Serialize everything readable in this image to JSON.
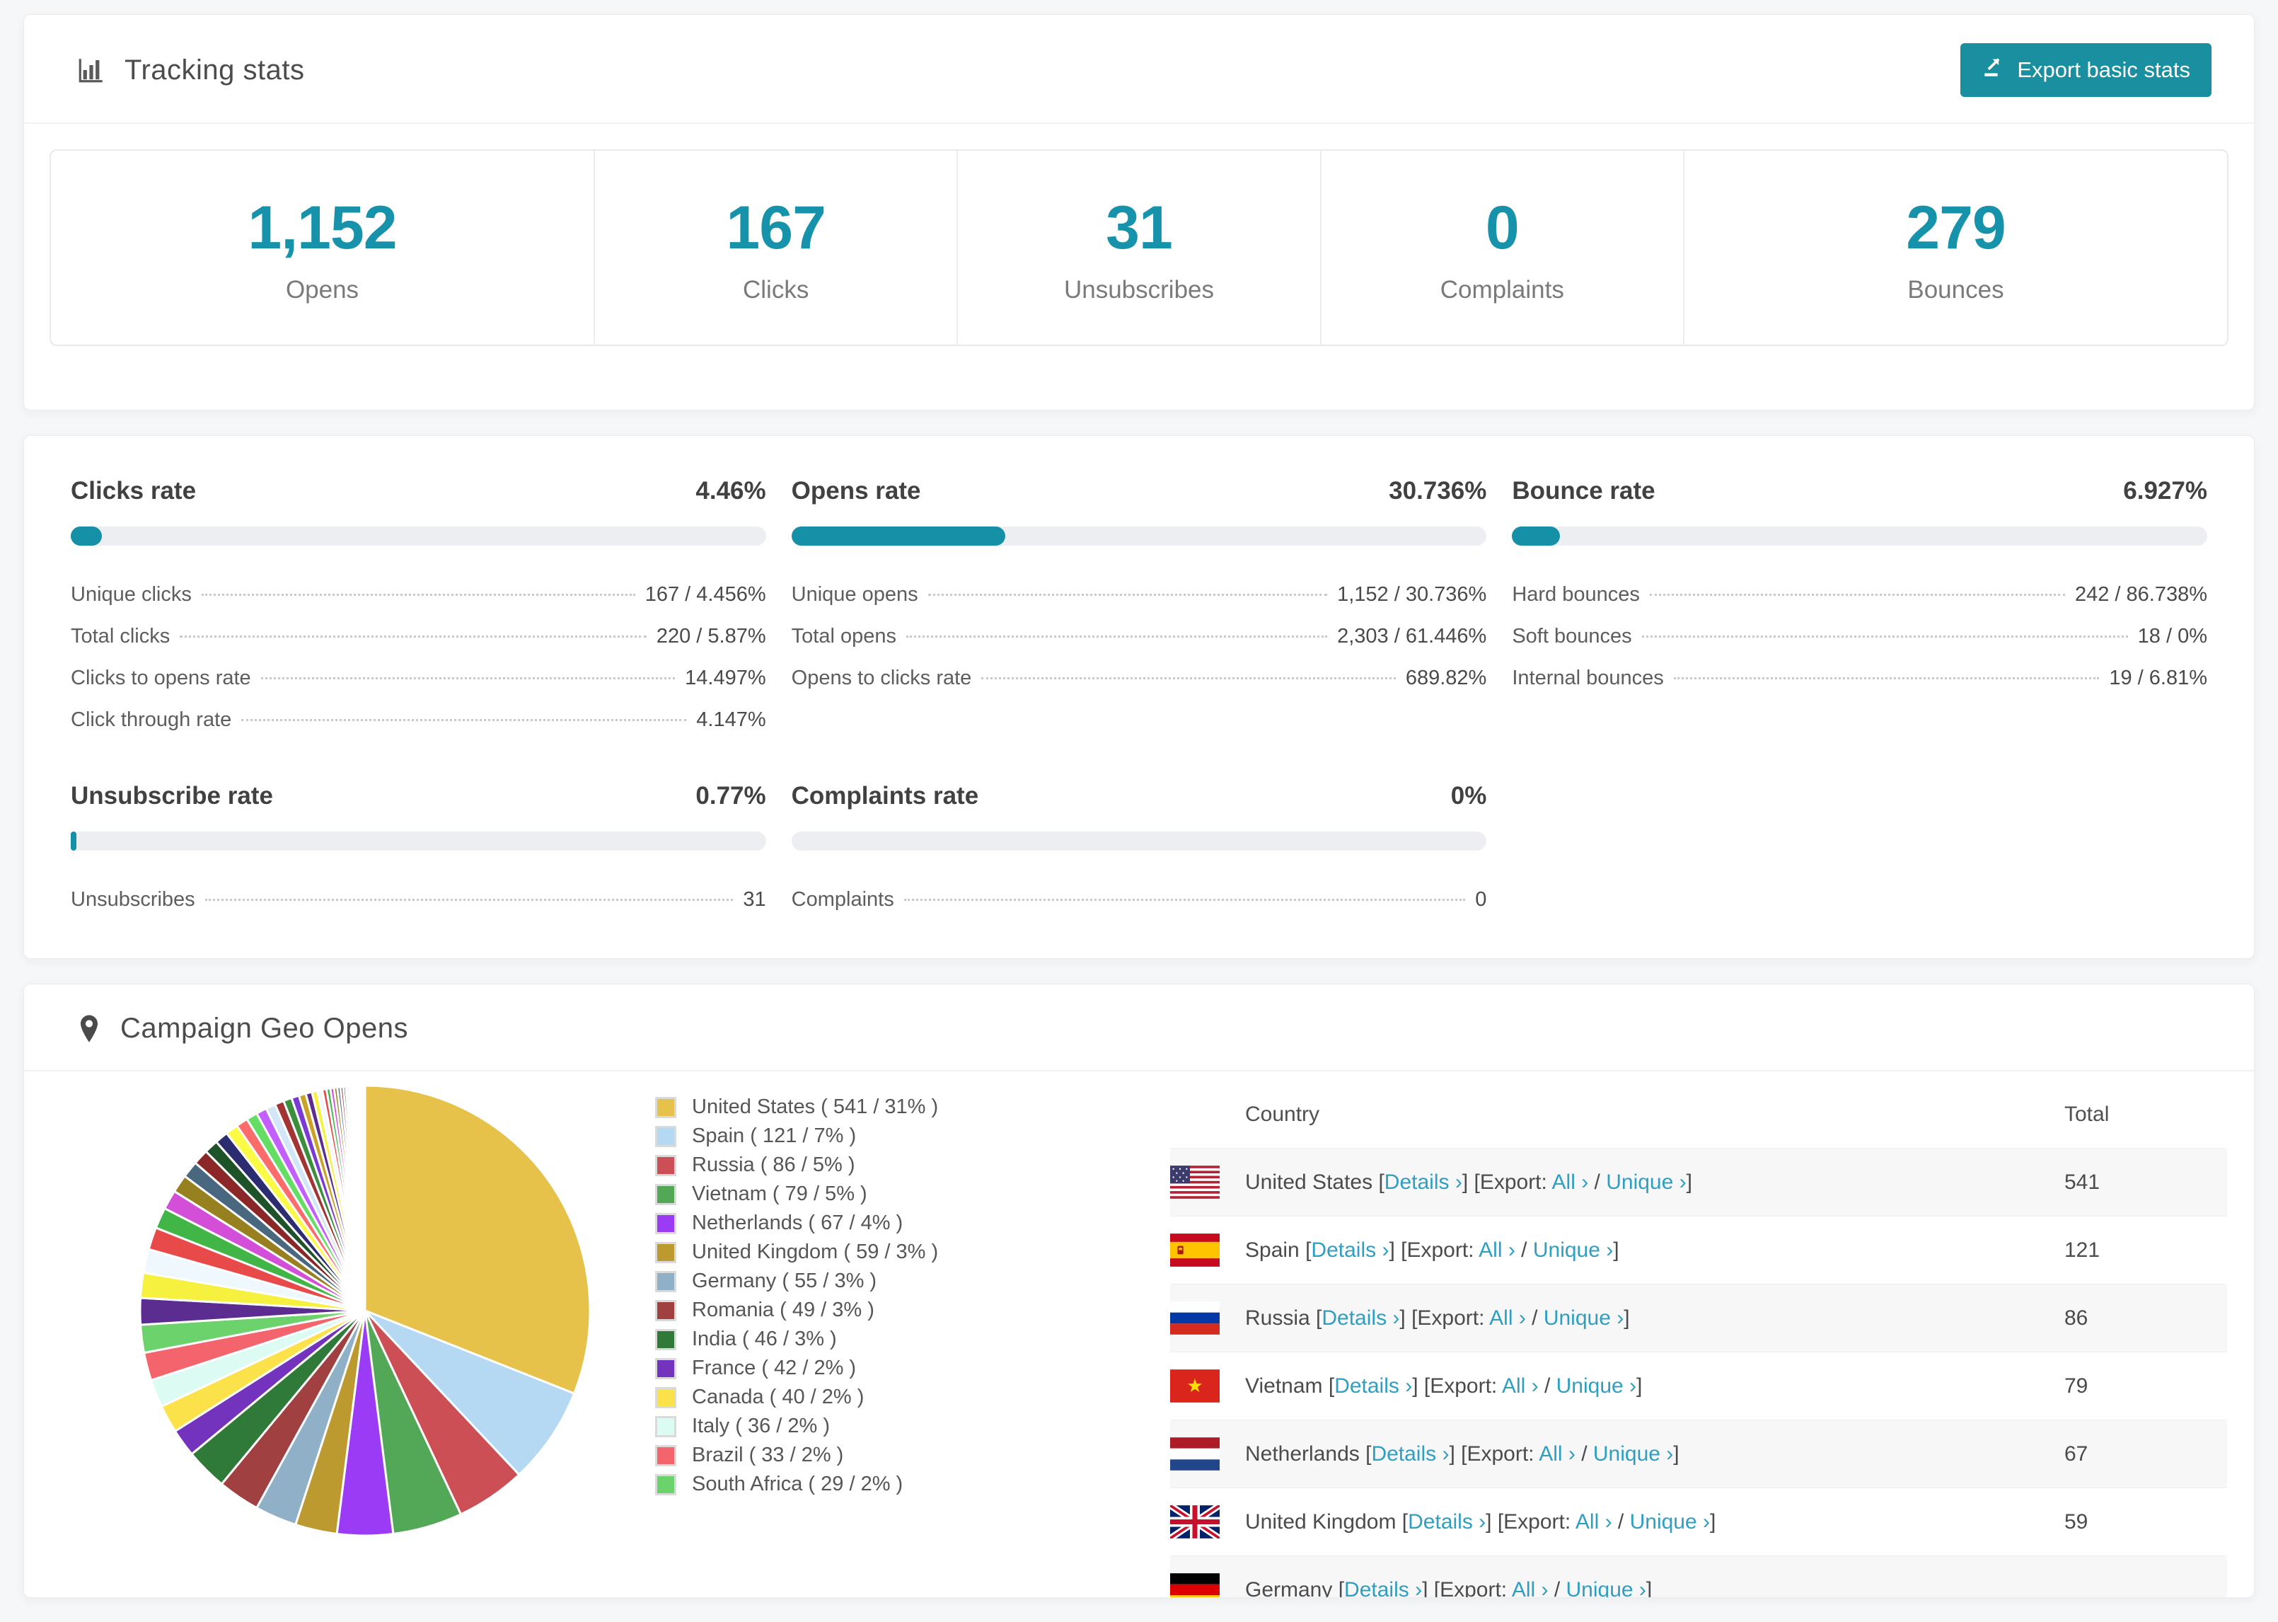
{
  "page": {
    "accent_button": "#1a8fa0",
    "accent_number": "#1792ab",
    "accent_bar": "#1590a6",
    "link_color": "#2f9fc1",
    "background": "#f6f7f8"
  },
  "tracking": {
    "title": "Tracking stats",
    "export_button": "Export basic stats",
    "stats": [
      {
        "value": "1,152",
        "label": "Opens"
      },
      {
        "value": "167",
        "label": "Clicks"
      },
      {
        "value": "31",
        "label": "Unsubscribes"
      },
      {
        "value": "0",
        "label": "Complaints"
      },
      {
        "value": "279",
        "label": "Bounces"
      }
    ]
  },
  "rates": {
    "sections": [
      {
        "title": "Clicks rate",
        "value": "4.46%",
        "percent": 4.46,
        "rows": [
          [
            "Unique clicks",
            "167 / 4.456%"
          ],
          [
            "Total clicks",
            "220 / 5.87%"
          ],
          [
            "Clicks to opens rate",
            "14.497%"
          ],
          [
            "Click through rate",
            "4.147%"
          ]
        ]
      },
      {
        "title": "Opens rate",
        "value": "30.736%",
        "percent": 30.736,
        "rows": [
          [
            "Unique opens",
            "1,152 / 30.736%"
          ],
          [
            "Total opens",
            "2,303 / 61.446%"
          ],
          [
            "Opens to clicks rate",
            "689.82%"
          ]
        ]
      },
      {
        "title": "Bounce rate",
        "value": "6.927%",
        "percent": 6.927,
        "rows": [
          [
            "Hard bounces",
            "242 / 86.738%"
          ],
          [
            "Soft bounces",
            "18 / 0%"
          ],
          [
            "Internal bounces",
            "19 / 6.81%"
          ]
        ]
      },
      {
        "title": "Unsubscribe rate",
        "value": "0.77%",
        "percent": 0.77,
        "rows": [
          [
            "Unsubscribes",
            "31"
          ]
        ]
      },
      {
        "title": "Complaints rate",
        "value": "0%",
        "percent": 0,
        "rows": [
          [
            "Complaints",
            "0"
          ]
        ]
      }
    ]
  },
  "geo": {
    "title": "Campaign Geo Opens",
    "table": {
      "headers": [
        "Country",
        "Total"
      ],
      "punctuation": {
        "open": "[",
        "close": "]",
        "slash": "/"
      },
      "labels": {
        "details": "Details ›",
        "export": "Export:",
        "all": "All ›",
        "unique": "Unique ›"
      },
      "rows": [
        {
          "country": "United States",
          "flag": "us",
          "total": "541"
        },
        {
          "country": "Spain",
          "flag": "es",
          "total": "121"
        },
        {
          "country": "Russia",
          "flag": "ru",
          "total": "86"
        },
        {
          "country": "Vietnam",
          "flag": "vn",
          "total": "79"
        },
        {
          "country": "Netherlands",
          "flag": "nl",
          "total": "67"
        },
        {
          "country": "United Kingdom",
          "flag": "gb",
          "total": "59"
        },
        {
          "country": "Germany",
          "flag": "de",
          "total": ""
        }
      ]
    }
  },
  "chart_data": {
    "type": "pie",
    "title": "Campaign Geo Opens",
    "legend_position": "right",
    "start_angle_deg": 0,
    "direction": "clockwise",
    "segments": [
      {
        "label": "United States",
        "value": 541,
        "pct": 31,
        "color": "#e7c24a"
      },
      {
        "label": "Spain",
        "value": 121,
        "pct": 7,
        "color": "#b5d9f3"
      },
      {
        "label": "Russia",
        "value": 86,
        "pct": 5,
        "color": "#cb4f55"
      },
      {
        "label": "Vietnam",
        "value": 79,
        "pct": 5,
        "color": "#53a858"
      },
      {
        "label": "Netherlands",
        "value": 67,
        "pct": 4,
        "color": "#9b3bf5"
      },
      {
        "label": "United Kingdom",
        "value": 59,
        "pct": 3,
        "color": "#bd9a30"
      },
      {
        "label": "Germany",
        "value": 55,
        "pct": 3,
        "color": "#8fb0c6"
      },
      {
        "label": "Romania",
        "value": 49,
        "pct": 3,
        "color": "#a04040"
      },
      {
        "label": "India",
        "value": 46,
        "pct": 3,
        "color": "#2f7a38"
      },
      {
        "label": "France",
        "value": 42,
        "pct": 2,
        "color": "#7333bd"
      },
      {
        "label": "Canada",
        "value": 40,
        "pct": 2,
        "color": "#fbe24b"
      },
      {
        "label": "Italy",
        "value": 36,
        "pct": 2,
        "color": "#dcfbf3"
      },
      {
        "label": "Brazil",
        "value": 33,
        "pct": 2,
        "color": "#f3646c"
      },
      {
        "label": "South Africa",
        "value": 29,
        "pct": 2,
        "color": "#6cd26c"
      }
    ],
    "other_segments_estimated_pct": [
      1.9,
      1.8,
      1.7,
      1.6,
      1.5,
      1.4,
      1.3,
      1.2,
      1.1,
      1.0,
      0.95,
      0.9,
      0.85,
      0.8,
      0.75,
      0.7,
      0.65,
      0.6,
      0.55,
      0.5,
      0.45,
      0.4,
      0.35,
      0.3,
      0.28,
      0.26,
      0.24,
      0.22,
      0.2,
      0.18,
      0.16,
      0.14,
      0.12,
      0.1,
      0.09,
      0.08,
      0.07,
      0.06,
      0.05
    ],
    "other_segments_palette": [
      "#5b2d91",
      "#f6f13e",
      "#eef8fe",
      "#e84a4a",
      "#41b546",
      "#d44fd8",
      "#97801f",
      "#49687f",
      "#8c2727",
      "#1e5329",
      "#2c2c70",
      "#fbfb46",
      "#fd6b6b",
      "#63de63",
      "#c45fff",
      "#d2e6f7",
      "#a33434",
      "#3b8e3b",
      "#7a3bd4",
      "#c9a227"
    ]
  }
}
